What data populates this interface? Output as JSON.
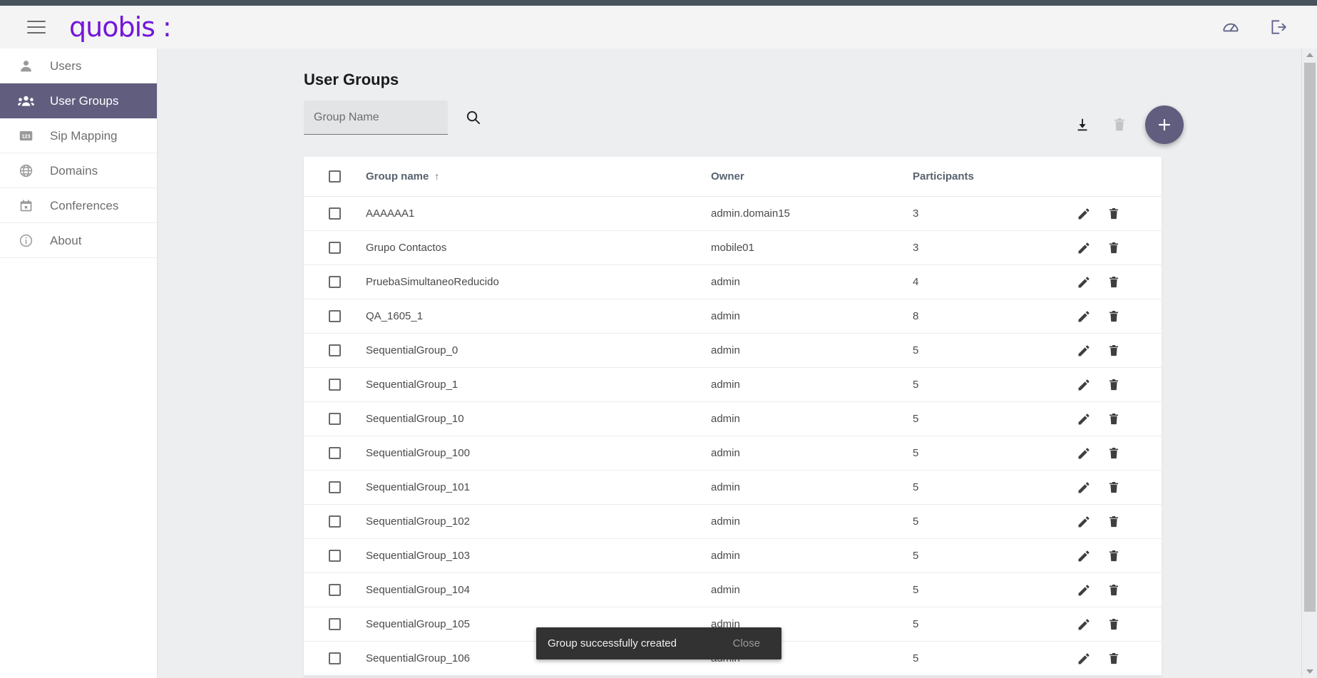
{
  "brand": {
    "name": "quobis :"
  },
  "appbar": {
    "menu_icon": "hamburger-icon",
    "actions": [
      {
        "name": "dashboard-icon",
        "label": "Dashboard"
      },
      {
        "name": "logout-icon",
        "label": "Logout"
      }
    ]
  },
  "sidebar": {
    "items": [
      {
        "label": "Users",
        "icon": "person-icon",
        "active": false
      },
      {
        "label": "User Groups",
        "icon": "group-icon",
        "active": true
      },
      {
        "label": "Sip Mapping",
        "icon": "numeric-123-icon",
        "active": false
      },
      {
        "label": "Domains",
        "icon": "globe-icon",
        "active": false
      },
      {
        "label": "Conferences",
        "icon": "calendar-icon",
        "active": false
      },
      {
        "label": "About",
        "icon": "info-icon",
        "active": false
      }
    ]
  },
  "main": {
    "title": "User Groups",
    "search": {
      "placeholder": "Group Name",
      "value": "",
      "button_icon": "search-icon"
    },
    "toolbar": {
      "download_label": "Download",
      "delete_label": "Delete",
      "add_label": "+"
    },
    "table": {
      "columns": {
        "select_all": "",
        "name": "Group name",
        "sort_indicator": "↑",
        "owner": "Owner",
        "participants": "Participants"
      },
      "rows": [
        {
          "name": "AAAAAA1",
          "owner": "admin.domain15",
          "participants": "3"
        },
        {
          "name": "Grupo Contactos",
          "owner": "mobile01",
          "participants": "3"
        },
        {
          "name": "PruebaSimultaneoReducido",
          "owner": "admin",
          "participants": "4"
        },
        {
          "name": "QA_1605_1",
          "owner": "admin",
          "participants": "8"
        },
        {
          "name": "SequentialGroup_0",
          "owner": "admin",
          "participants": "5"
        },
        {
          "name": "SequentialGroup_1",
          "owner": "admin",
          "participants": "5"
        },
        {
          "name": "SequentialGroup_10",
          "owner": "admin",
          "participants": "5"
        },
        {
          "name": "SequentialGroup_100",
          "owner": "admin",
          "participants": "5"
        },
        {
          "name": "SequentialGroup_101",
          "owner": "admin",
          "participants": "5"
        },
        {
          "name": "SequentialGroup_102",
          "owner": "admin",
          "participants": "5"
        },
        {
          "name": "SequentialGroup_103",
          "owner": "admin",
          "participants": "5"
        },
        {
          "name": "SequentialGroup_104",
          "owner": "admin",
          "participants": "5"
        },
        {
          "name": "SequentialGroup_105",
          "owner": "admin",
          "participants": "5"
        },
        {
          "name": "SequentialGroup_106",
          "owner": "admin",
          "participants": "5"
        }
      ]
    }
  },
  "snackbar": {
    "message": "Group successfully created",
    "close_label": "Close"
  },
  "colors": {
    "brand_purple": "#7317d8",
    "accent_slate_purple": "#605d7e",
    "page_background": "#eceef0",
    "snackbar_background": "#323232",
    "top_strip": "#47525d"
  }
}
